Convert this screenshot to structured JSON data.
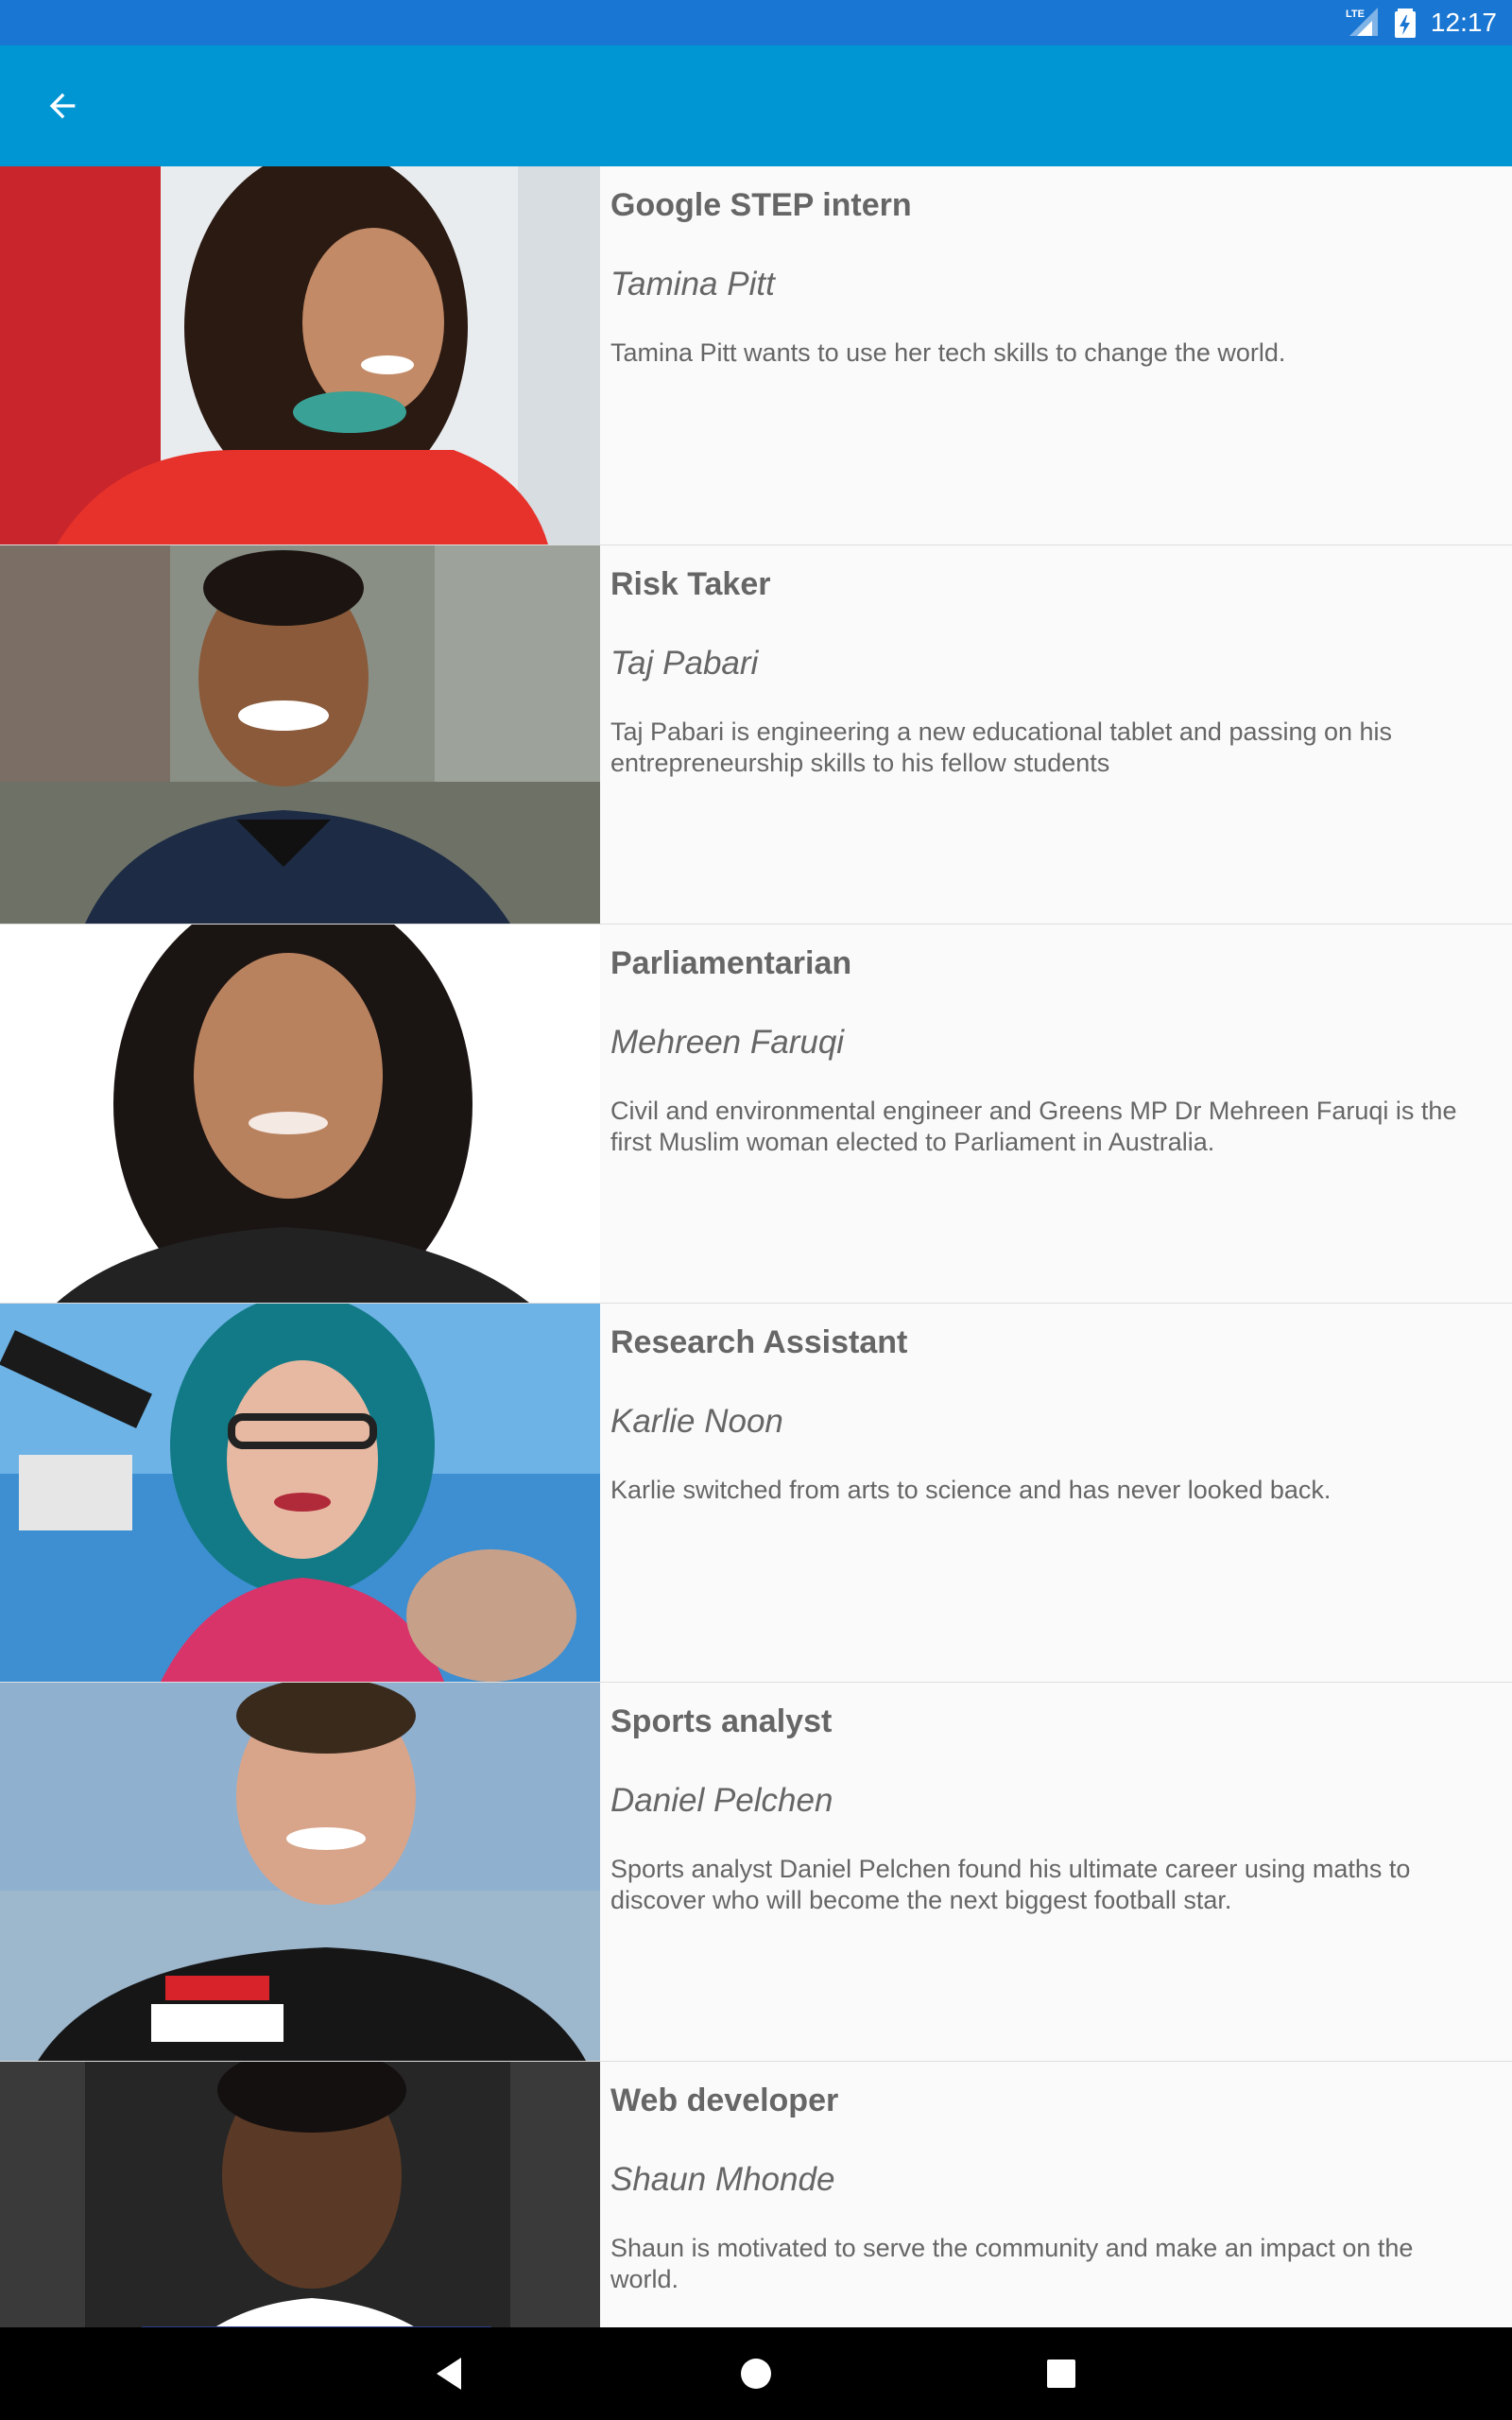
{
  "status_bar": {
    "time": "12:17",
    "network": "LTE",
    "icons": [
      "lte-signal-icon",
      "battery-charging-icon"
    ],
    "background_color": "#1976d2"
  },
  "app_bar": {
    "back_icon": "arrow-left-icon",
    "background_color": "#0096d3"
  },
  "profiles": [
    {
      "role": "Google STEP intern",
      "name": "Tamina Pitt",
      "description": "Tamina Pitt wants to use her tech skills to change the world."
    },
    {
      "role": "Risk Taker",
      "name": "Taj Pabari",
      "description": "Taj Pabari is engineering a new educational tablet and passing on his entrepreneurship skills to his fellow students"
    },
    {
      "role": "Parliamentarian",
      "name": "Mehreen Faruqi",
      "description": "Civil and environmental engineer and Greens MP Dr Mehreen Faruqi is the first Muslim woman elected to Parliament in Australia."
    },
    {
      "role": "Research Assistant",
      "name": "Karlie Noon",
      "description": "Karlie switched from arts to science and has never looked back."
    },
    {
      "role": "Sports analyst",
      "name": "Daniel Pelchen",
      "description": "Sports analyst Daniel Pelchen found his ultimate career using maths to discover who will become the next biggest football star."
    },
    {
      "role": "Web developer",
      "name": "Shaun Mhonde",
      "description": "Shaun is motivated to serve the community and make an impact on the world."
    }
  ],
  "nav_bar": {
    "icons": [
      "back-triangle-icon",
      "home-circle-icon",
      "recents-square-icon"
    ]
  }
}
